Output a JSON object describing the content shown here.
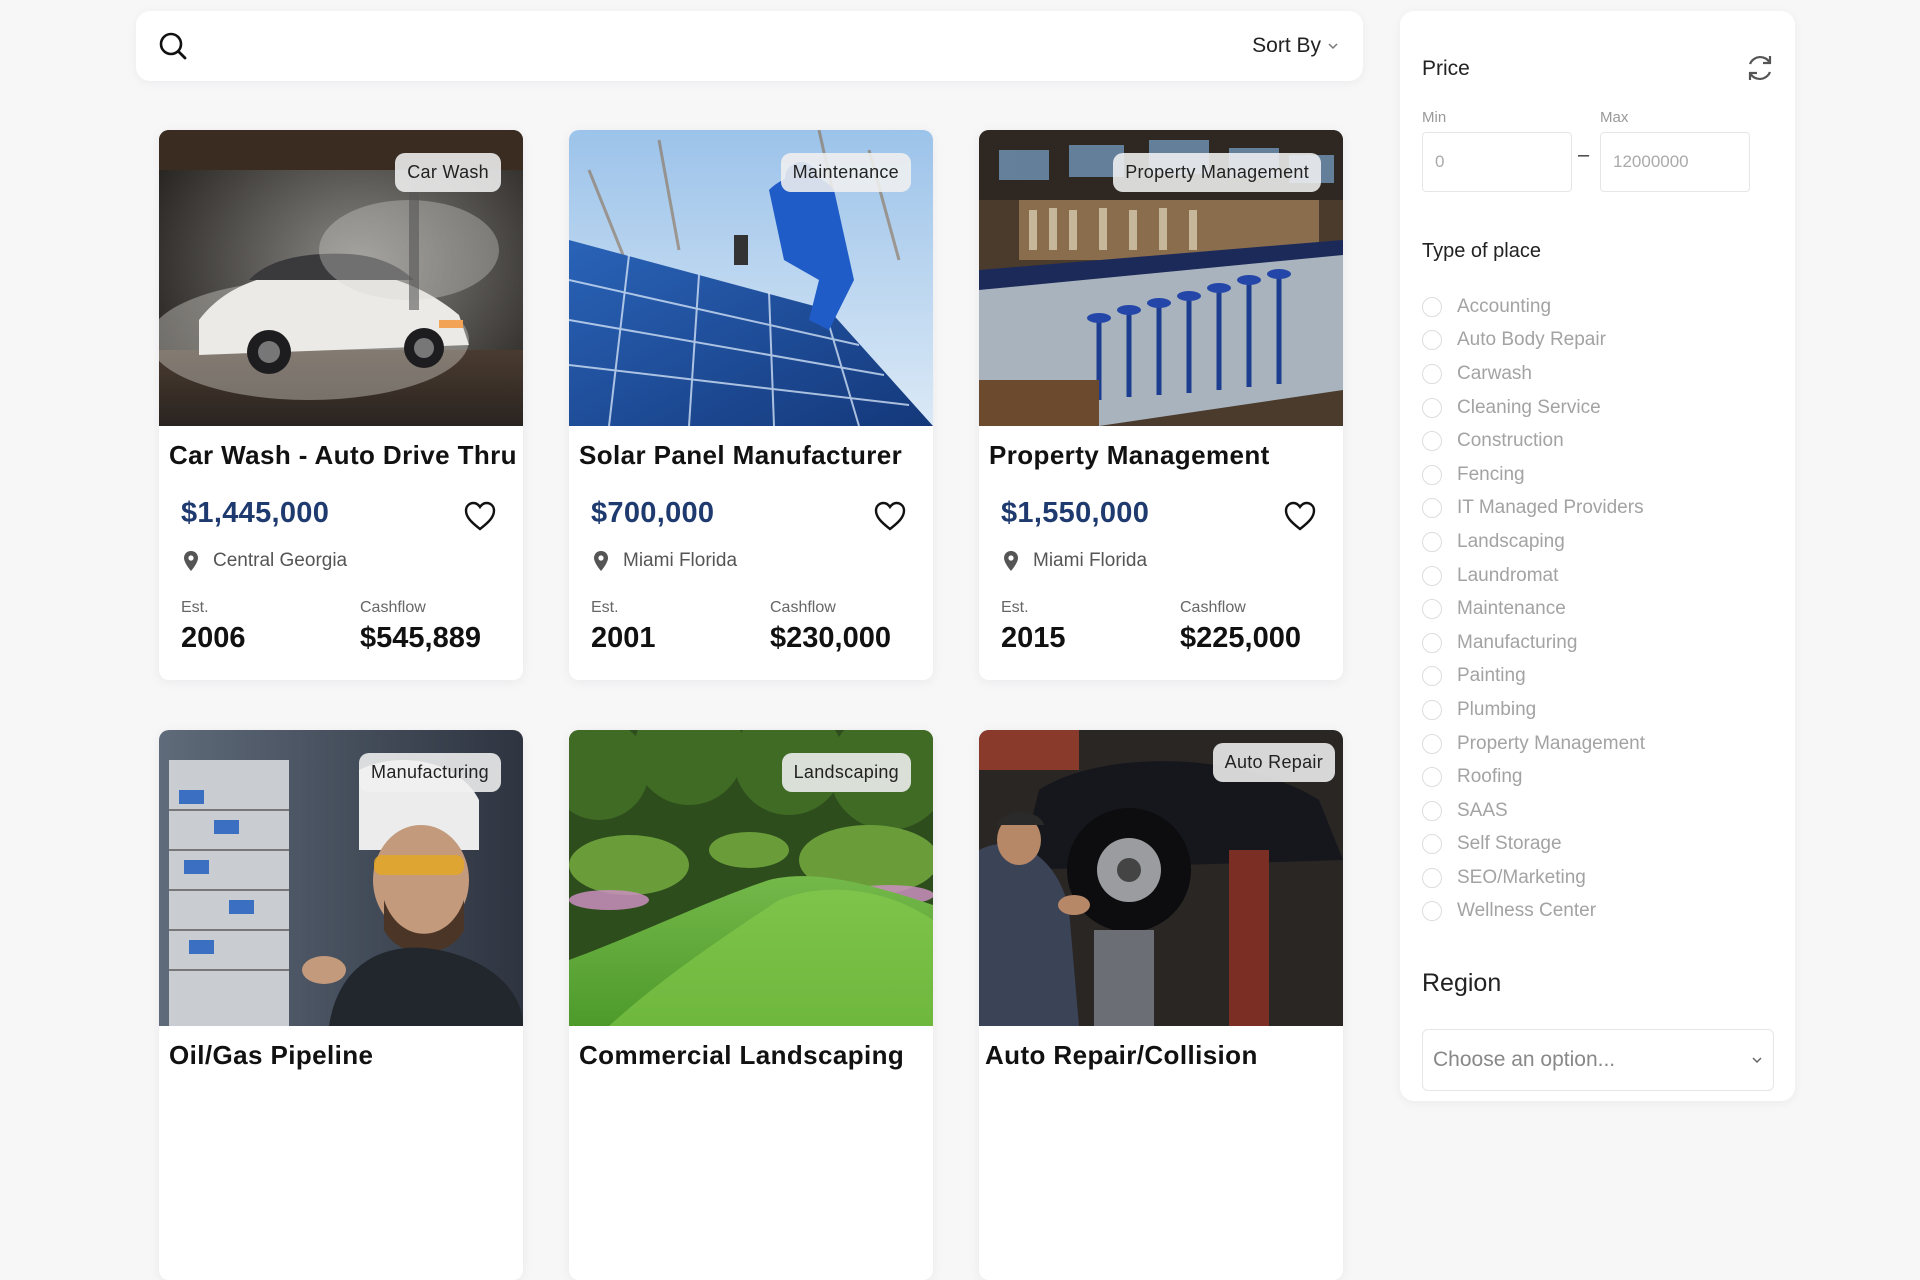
{
  "search": {
    "icon": "search-icon",
    "sort_label": "Sort By"
  },
  "listings": [
    {
      "badge": "Car Wash",
      "title": "Car Wash - Auto Drive Thru",
      "price": "$1,445,000",
      "location": "Central Georgia",
      "est_label": "Est.",
      "est": "2006",
      "cashflow_label": "Cashflow",
      "cashflow": "$545,889"
    },
    {
      "badge": "Maintenance",
      "title": "Solar Panel Manufacturer",
      "price": "$700,000",
      "location": "Miami Florida",
      "est_label": "Est.",
      "est": "2001",
      "cashflow_label": "Cashflow",
      "cashflow": "$230,000"
    },
    {
      "badge": "Property Management",
      "title": "Property Management",
      "price": "$1,550,000",
      "location": "Miami Florida",
      "est_label": "Est.",
      "est": "2015",
      "cashflow_label": "Cashflow",
      "cashflow": "$225,000"
    },
    {
      "badge": "Manufacturing",
      "title": "Oil/Gas Pipeline"
    },
    {
      "badge": "Landscaping",
      "title": "Commercial Landscaping"
    },
    {
      "badge": "Auto Repair",
      "title": "Auto Repair/Collision"
    }
  ],
  "filters": {
    "price_title": "Price",
    "min_label": "Min",
    "max_label": "Max",
    "min_value": "0",
    "max_value": "12000000",
    "range_dash": "–",
    "type_title": "Type of place",
    "types": [
      "Accounting",
      "Auto Body Repair",
      "Carwash",
      "Cleaning Service",
      "Construction",
      "Fencing",
      "IT Managed Providers",
      "Landscaping",
      "Laundromat",
      "Maintenance",
      "Manufacturing",
      "Painting",
      "Plumbing",
      "Property Management",
      "Roofing",
      "SAAS",
      "Self Storage",
      "SEO/Marketing",
      "Wellness Center"
    ],
    "region_title": "Region",
    "region_placeholder": "Choose an option..."
  },
  "colors": {
    "price": "#1e3a6e",
    "page_bg": "#f7f7f8"
  }
}
